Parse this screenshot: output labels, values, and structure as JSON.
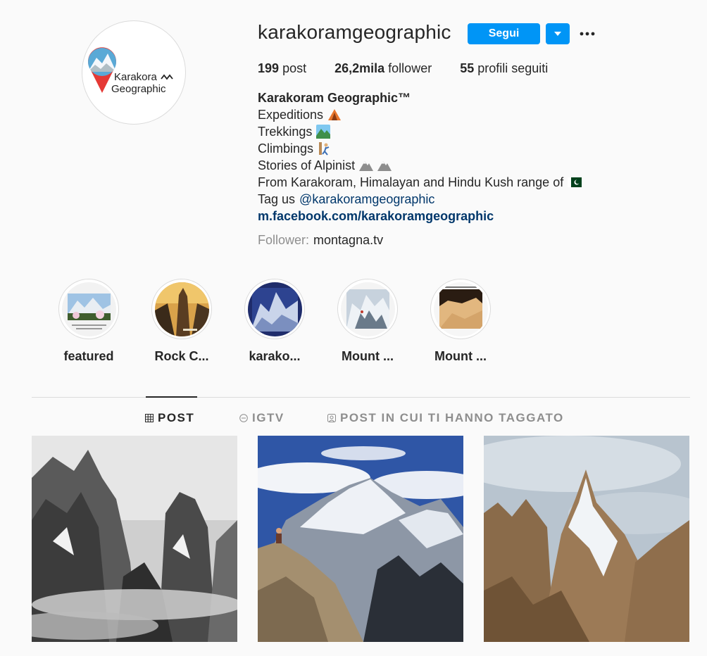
{
  "profile": {
    "username": "karakoramgeographic",
    "follow_label": "Segui",
    "avatar": {
      "line1": "Karakora",
      "line2": "Geographic"
    }
  },
  "stats": {
    "posts_value": "199",
    "posts_label": "post",
    "followers_value": "26,2mila",
    "followers_label": "follower",
    "following_value": "55",
    "following_label": "profili seguiti"
  },
  "bio": {
    "name": "Karakoram Geographic™",
    "lines": [
      "Expeditions",
      "Trekkings",
      "Climbings",
      "Stories of Alpinist",
      "From Karakoram, Himalayan and Hindu Kush range of"
    ],
    "tag_prefix": "Tag us",
    "tag_mention": "@karakoramgeographic",
    "link": "m.facebook.com/karakoramgeographic",
    "followed_label": "Follower:",
    "followed_name": "montagna.tv"
  },
  "highlights": [
    {
      "label": "featured"
    },
    {
      "label": "Rock C..."
    },
    {
      "label": "karako..."
    },
    {
      "label": "Mount ..."
    },
    {
      "label": "Mount ..."
    }
  ],
  "tabs": [
    {
      "label": "POST",
      "icon": "grid-icon"
    },
    {
      "label": "IGTV",
      "icon": "igtv-icon"
    },
    {
      "label": "POST IN CUI TI HANNO TAGGATO",
      "icon": "tagged-icon"
    }
  ],
  "colors": {
    "accent": "#0095f6",
    "link": "#00376b",
    "muted": "#8e8e8e",
    "text": "#262626",
    "background": "#fafafa"
  }
}
